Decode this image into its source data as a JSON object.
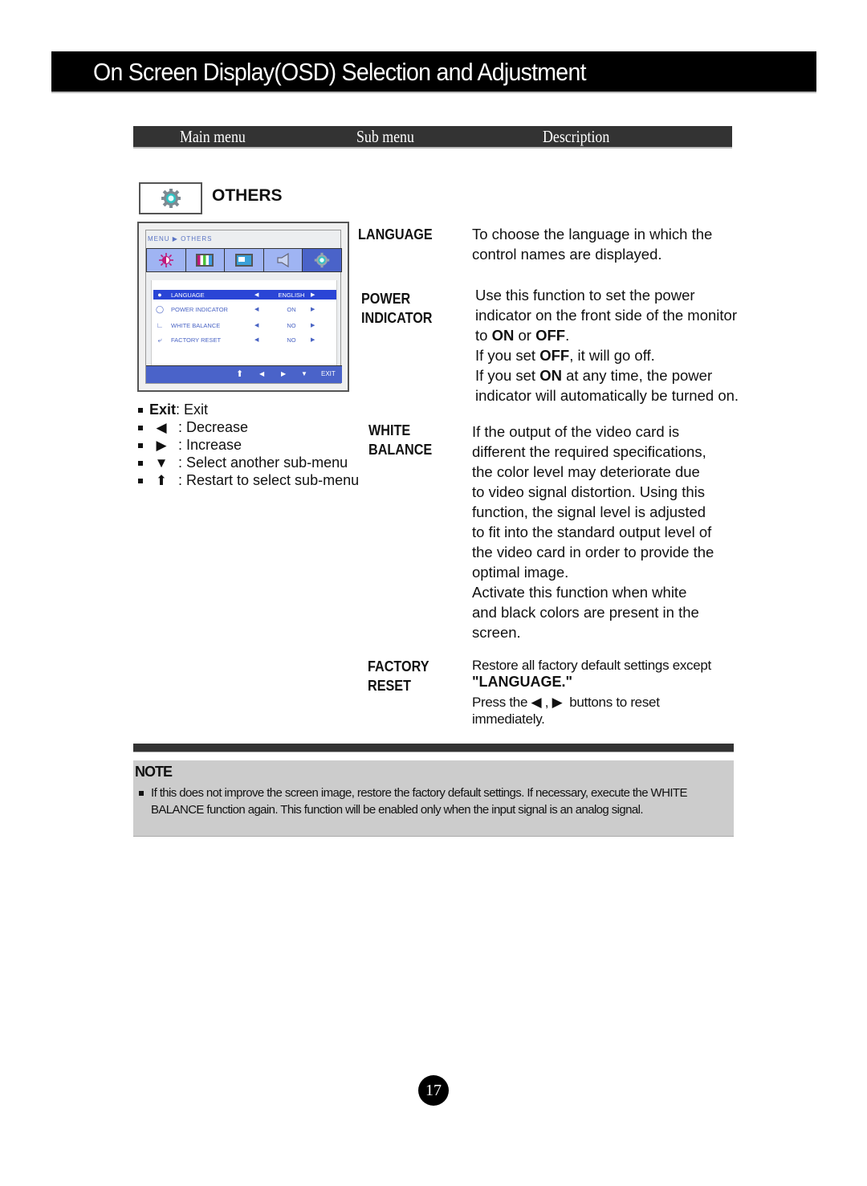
{
  "page": {
    "title": "On Screen Display(OSD) Selection and Adjustment",
    "page_number": "17"
  },
  "table_header": {
    "main_menu": "Main menu",
    "sub_menu": "Sub menu",
    "description": "Description"
  },
  "section": {
    "title": "OTHERS",
    "icon": "gear-icon"
  },
  "osd": {
    "breadcrumb": "MENU ▶ OTHERS",
    "tabs": [
      {
        "icon": "brightness-icon",
        "active": false
      },
      {
        "icon": "color-icon",
        "active": false
      },
      {
        "icon": "display-icon",
        "active": false
      },
      {
        "icon": "speaker-icon",
        "active": false
      },
      {
        "icon": "gear-icon",
        "active": true
      }
    ],
    "rows": [
      {
        "icon": "globe-icon",
        "label": "LANGUAGE",
        "value": "ENGLISH",
        "selected": true
      },
      {
        "icon": "power-indicator-icon",
        "label": "POWER INDICATOR",
        "value": "ON",
        "selected": false
      },
      {
        "icon": "white-balance-icon",
        "label": "WHITE BALANCE",
        "value": "NO",
        "selected": false
      },
      {
        "icon": "reset-icon",
        "label": "FACTORY RESET",
        "value": "NO",
        "selected": false
      }
    ],
    "footer": {
      "up": "⬆",
      "left": "◀",
      "right": "▶",
      "down": "▼",
      "exit": "EXIT"
    }
  },
  "legend": [
    {
      "symbol": "Exit",
      "text": " : Exit"
    },
    {
      "symbol": "◀",
      "text": ": Decrease"
    },
    {
      "symbol": "▶",
      "text": ": Increase"
    },
    {
      "symbol": "▼",
      "text": ": Select another sub-menu"
    },
    {
      "symbol": "⬆",
      "text": ": Restart to select sub-menu"
    }
  ],
  "submenus": {
    "language": {
      "label": "LANGUAGE",
      "desc": [
        "To choose the language in which the",
        "control names are displayed."
      ]
    },
    "power_indicator": {
      "label_1": "POWER",
      "label_2": "INDICATOR",
      "line1": "Use this function to set the power",
      "line2": "indicator on the front side of the monitor",
      "line3_a": "to ",
      "line3_b": "ON",
      "line3_c": " or ",
      "line3_d": "OFF",
      "line3_e": ".",
      "line4_a": "If you set ",
      "line4_b": "OFF",
      "line4_c": ", it will go off.",
      "line5_a": "If you set ",
      "line5_b": "ON",
      "line5_c": " at any time, the power",
      "line6": "indicator will automatically be turned on."
    },
    "white_balance": {
      "label_1": "WHITE",
      "label_2": "BALANCE",
      "desc": [
        "If the output of the video card is",
        "different the required specifications,",
        "the color level may deteriorate due",
        "to video signal distortion. Using this",
        "function, the signal level is adjusted",
        "to fit into the standard output level of",
        "the video card in order to provide the",
        "optimal image.",
        "Activate this function when white",
        "and black colors are present in the",
        "screen."
      ]
    },
    "factory_reset": {
      "label_1": "FACTORY",
      "label_2": "RESET",
      "line1": "Restore all factory default settings except",
      "line2": "\"LANGUAGE.\"",
      "line3_a": "Press the ",
      "line3_left": "◀",
      "line3_sep": " , ",
      "line3_right": "▶",
      "line3_b": "  buttons to reset",
      "line4": "immediately."
    }
  },
  "note": {
    "title": "NOTE",
    "text": "If this does not improve the screen image, restore the factory default settings. If necessary, execute the WHITE BALANCE function again. This function will be enabled only when the input signal is an analog signal."
  }
}
